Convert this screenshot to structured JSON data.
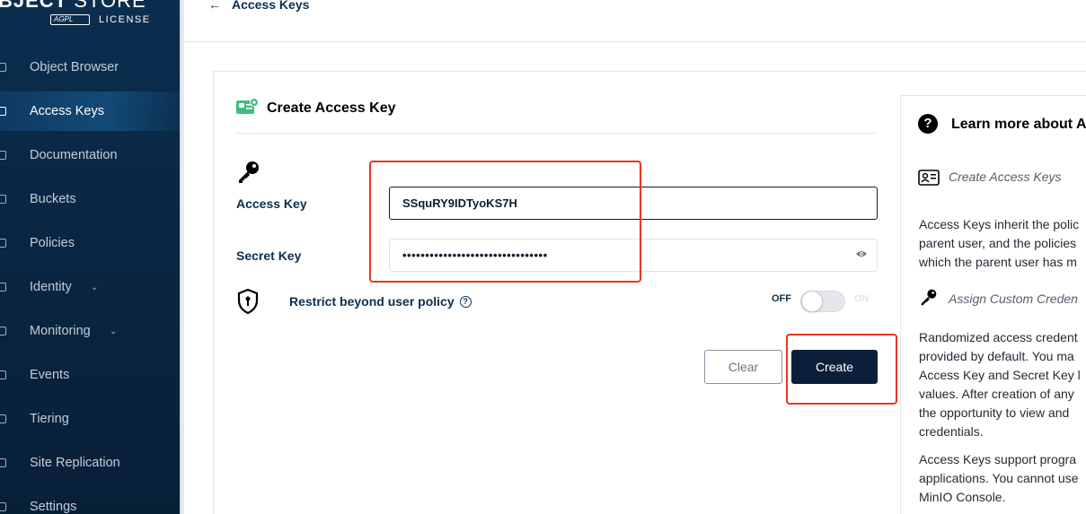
{
  "sidebar": {
    "logo_main": "BJECT",
    "logo_thin": "STORE",
    "logo_badge": "AGPL",
    "logo_license": "LICENSE",
    "items": [
      {
        "label": "Object Browser",
        "icon": "object-browser-icon"
      },
      {
        "label": "Access Keys",
        "icon": "access-keys-icon",
        "active": true
      },
      {
        "label": "Documentation",
        "icon": "documentation-icon"
      },
      {
        "label": "Buckets",
        "icon": "buckets-icon"
      },
      {
        "label": "Policies",
        "icon": "policies-icon"
      },
      {
        "label": "Identity",
        "icon": "identity-icon",
        "expandable": true
      },
      {
        "label": "Monitoring",
        "icon": "monitoring-icon",
        "expandable": true
      },
      {
        "label": "Events",
        "icon": "events-icon"
      },
      {
        "label": "Tiering",
        "icon": "tiering-icon"
      },
      {
        "label": "Site Replication",
        "icon": "site-replication-icon"
      },
      {
        "label": "Settings",
        "icon": "settings-icon"
      }
    ]
  },
  "topbar": {
    "back_label": "Access Keys"
  },
  "form": {
    "title": "Create Access Key",
    "access_key_label": "Access Key",
    "access_key_value": "SSquRY9IDTyoKS7H",
    "secret_key_label": "Secret Key",
    "secret_key_value": "••••••••••••••••••••••••••••••••",
    "restrict_label": "Restrict beyond user policy",
    "toggle_off": "OFF",
    "toggle_on": "ON",
    "toggle_state": "off",
    "clear_label": "Clear",
    "create_label": "Create"
  },
  "help": {
    "title": "Learn more about A",
    "sub1": "Create Access Keys",
    "para1": [
      "Access Keys inherit the polic",
      "parent user, and the policies",
      "which the parent user has m"
    ],
    "sub2": "Assign Custom Creden",
    "para2": [
      "Randomized access credent",
      "provided by default. You ma",
      "Access Key and Secret Key l",
      "values. After creation of any",
      "the opportunity to view and",
      "credentials."
    ],
    "para3": [
      "Access Keys support progra",
      "applications. You cannot use",
      "MinIO Console."
    ]
  },
  "colors": {
    "sidebar_bg": "#0b2e4f",
    "primary": "#0b1e3a",
    "annotation": "#e8371e",
    "accent_green": "#3fbf7f"
  }
}
